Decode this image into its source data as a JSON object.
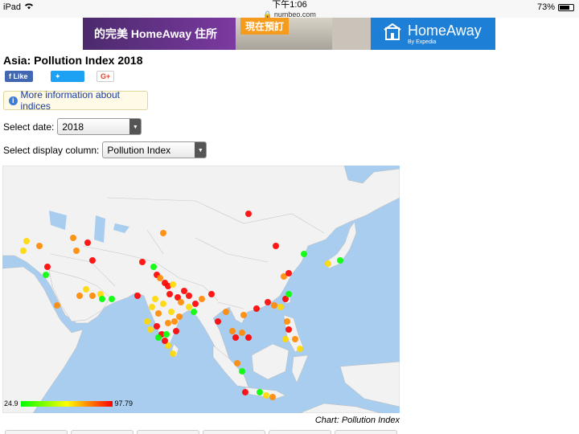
{
  "status": {
    "device": "iPad",
    "time": "下午1:06",
    "url": "numbeo.com",
    "battery": "73%",
    "battery_level": 0.73
  },
  "ad": {
    "text_left": "的完美 HomeAway 住所",
    "cta": "現在預訂",
    "brand": "HomeAway",
    "brand_sub": "By Expedia"
  },
  "page": {
    "title": "Asia: Pollution Index 2018",
    "like_label": "Like",
    "tweet_label": "Tweet",
    "gplus_label": "G+",
    "info_link": "More information about indices"
  },
  "controls": {
    "date_label": "Select date:",
    "date_value": "2018",
    "column_label": "Select display column:",
    "column_value": "Pollution Index"
  },
  "legend": {
    "min": "24.9",
    "max": "97.79"
  },
  "caption": "Chart: Pollution Index",
  "colors": {
    "sea": "#a8cdee",
    "land": "#f2f2f2",
    "low": "#00ff00",
    "mid": "#ffff00",
    "high": "#ff0000"
  }
}
